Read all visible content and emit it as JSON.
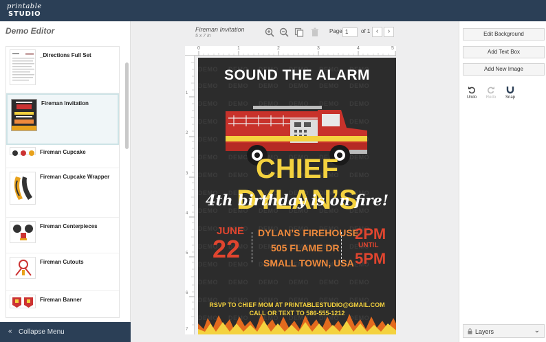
{
  "app": {
    "logo_line1": "printable",
    "logo_line2": "STUDIO"
  },
  "sidebar": {
    "title": "Demo Editor",
    "items": [
      {
        "label": "_Directions Full Set"
      },
      {
        "label": "Fireman Invitation",
        "selected": true
      },
      {
        "label": "Fireman Cupcake"
      },
      {
        "label": "Fireman Cupcake Wrapper"
      },
      {
        "label": "Fireman Centerpieces"
      },
      {
        "label": "Fireman Cutouts"
      },
      {
        "label": "Fireman Banner"
      }
    ],
    "collapse_label": "Collapse Menu"
  },
  "toolbar": {
    "doc_name": "Fireman Invitation",
    "doc_size": "5 x 7 in",
    "page_label": "Page",
    "page_value": "1",
    "page_of": "of 1",
    "icons": [
      "zoom-in-icon",
      "zoom-out-icon",
      "copy-icon",
      "trash-icon",
      "chevron-left-icon",
      "chevron-right-icon"
    ]
  },
  "rulers": {
    "top": [
      "0",
      "1",
      "2",
      "3",
      "4",
      "5"
    ],
    "left": [
      "1",
      "2",
      "3",
      "4",
      "5",
      "6",
      "7"
    ]
  },
  "invitation": {
    "watermark": "DEMO",
    "headline": "SOUND THE ALARM",
    "name": "CHIEF DYLAN’S",
    "subline": "4th birthday is on fire!",
    "month": "JUNE",
    "day": "22",
    "address1": "DYLAN’S FIREHOUSE",
    "address2": "505 FLAME DR",
    "address3": "SMALL TOWN, USA",
    "time_start": "2PM",
    "until": "UNTIL",
    "time_end": "5PM",
    "rsvp1": "RSVP TO CHIEF MOM AT PRINTABLESTUDIO@GMAIL.COM",
    "rsvp2": "CALL OR TEXT TO 586-555-1212"
  },
  "right_panel": {
    "edit_background": "Edit Background",
    "add_text_box": "Add Text Box",
    "add_new_image": "Add New Image",
    "undo": "Undo",
    "redo": "Redo",
    "snap": "Snap",
    "layers": "Layers"
  },
  "colors": {
    "topbar": "#2b3f56",
    "invite_bg": "#2c2c2c",
    "yellow": "#f4d23f",
    "red": "#e0452f",
    "orange": "#ef8a3c"
  }
}
